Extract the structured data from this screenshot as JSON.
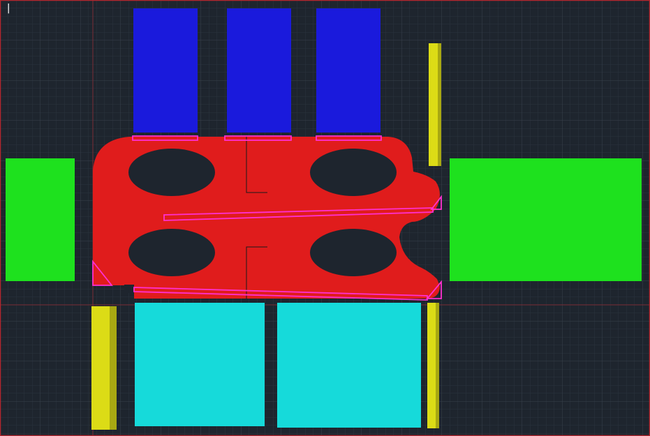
{
  "canvas": {
    "background": "#1e252e",
    "grid_minor": "#2b333d",
    "grid_major": "#38414c",
    "frame": "#b3262e",
    "axis_line": "#7a2d35"
  },
  "colors": {
    "blue": "#1a1adc",
    "green": "#1ee11e",
    "cyan": "#16dada",
    "yellow": "#dcdc16",
    "yellow_shade": "#a8a812",
    "red": "#e01c1c",
    "magenta": "#ff2fd0",
    "hole": "#1e252e",
    "black_line": "#1a1a1a"
  },
  "cursor": {
    "symbol": "|"
  }
}
